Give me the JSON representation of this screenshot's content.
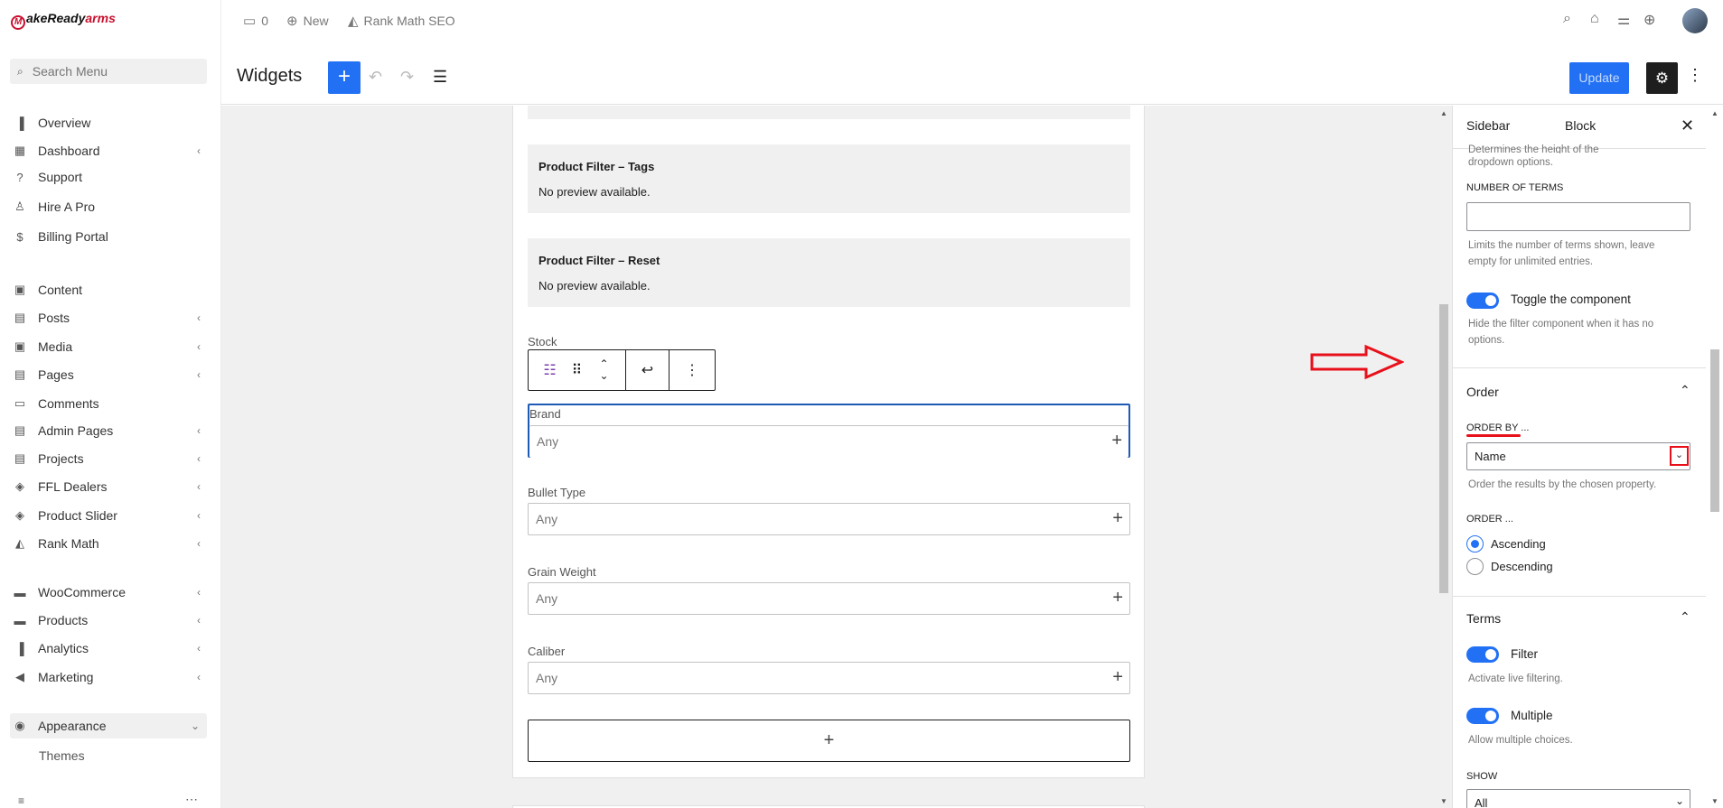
{
  "brand": {
    "logo_letter": "M",
    "logo_text": "akeReady",
    "logo_accent": "arms"
  },
  "sidebar": {
    "search_placeholder": "Search Menu",
    "items": [
      {
        "label": "Overview",
        "icon": "bar-chart-icon",
        "glyph": "▐"
      },
      {
        "label": "Dashboard",
        "icon": "grid-icon",
        "glyph": "▦"
      },
      {
        "label": "Support",
        "icon": "question-icon",
        "glyph": "?"
      },
      {
        "label": "Hire A Pro",
        "icon": "person-icon",
        "glyph": "♙"
      },
      {
        "label": "Billing Portal",
        "icon": "dollar-icon",
        "glyph": "$"
      },
      {
        "label": "Content",
        "icon": "image-icon",
        "glyph": "▣"
      },
      {
        "label": "Posts",
        "icon": "document-icon",
        "glyph": "▤"
      },
      {
        "label": "Media",
        "icon": "media-icon",
        "glyph": "▣"
      },
      {
        "label": "Pages",
        "icon": "pages-icon",
        "glyph": "▤"
      },
      {
        "label": "Comments",
        "icon": "comment-icon",
        "glyph": "▭"
      },
      {
        "label": "Admin Pages",
        "icon": "admin-pages-icon",
        "glyph": "▤"
      },
      {
        "label": "Projects",
        "icon": "projects-icon",
        "glyph": "▤"
      },
      {
        "label": "FFL Dealers",
        "icon": "dealers-icon",
        "glyph": "◈"
      },
      {
        "label": "Product Slider",
        "icon": "slider-icon",
        "glyph": "◈"
      },
      {
        "label": "Rank Math",
        "icon": "rank-math-icon",
        "glyph": "◭"
      },
      {
        "label": "WooCommerce",
        "icon": "woocommerce-icon",
        "glyph": "▬"
      },
      {
        "label": "Products",
        "icon": "products-icon",
        "glyph": "▬"
      },
      {
        "label": "Analytics",
        "icon": "analytics-icon",
        "glyph": "▐"
      },
      {
        "label": "Marketing",
        "icon": "megaphone-icon",
        "glyph": "◀"
      },
      {
        "label": "Appearance",
        "icon": "palette-icon",
        "glyph": "◉"
      }
    ],
    "sub_item": "Themes",
    "collapse_glyph": "≡",
    "dots": "⋯"
  },
  "adminbar": {
    "comments_count": "0",
    "new_label": "New",
    "seo_label": "Rank Math SEO"
  },
  "editor": {
    "title": "Widgets",
    "update_label": "Update",
    "add_glyph": "+"
  },
  "canvas": {
    "tags_title": "Product Filter – Tags",
    "tags_note": "No preview available.",
    "reset_title": "Product Filter – Reset",
    "reset_note": "No preview available.",
    "stock_label": "Stock",
    "fields": [
      {
        "label": "Brand",
        "placeholder": "Any"
      },
      {
        "label": "Bullet Type",
        "placeholder": "Any"
      },
      {
        "label": "Grain Weight",
        "placeholder": "Any"
      },
      {
        "label": "Caliber",
        "placeholder": "Any"
      }
    ]
  },
  "settings": {
    "tab_sidebar": "Sidebar",
    "tab_block": "Block",
    "cut_help_line1": "Determines the height of the",
    "cut_help_line2": "dropdown options.",
    "number_of_terms_label": "NUMBER OF TERMS",
    "number_of_terms_value": "",
    "number_of_terms_help": "Limits the number of terms shown, leave empty for unlimited entries.",
    "toggle_component_label": "Toggle the component",
    "toggle_component_help": "Hide the filter component when it has no options.",
    "order_heading": "Order",
    "order_by_label": "ORDER BY ...",
    "order_by_value": "Name",
    "order_by_help": "Order the results by the chosen property.",
    "order_label": "ORDER ...",
    "order_options": [
      "Ascending",
      "Descending"
    ],
    "order_selected": "Ascending",
    "terms_heading": "Terms",
    "filter_label": "Filter",
    "filter_help": "Activate live filtering.",
    "multiple_label": "Multiple",
    "multiple_help": "Allow multiple choices.",
    "show_label": "SHOW",
    "show_value": "All"
  },
  "colors": {
    "accent": "#2271f5",
    "annotation": "#e8101b",
    "toolbar_dark": "#1e1e1e"
  }
}
